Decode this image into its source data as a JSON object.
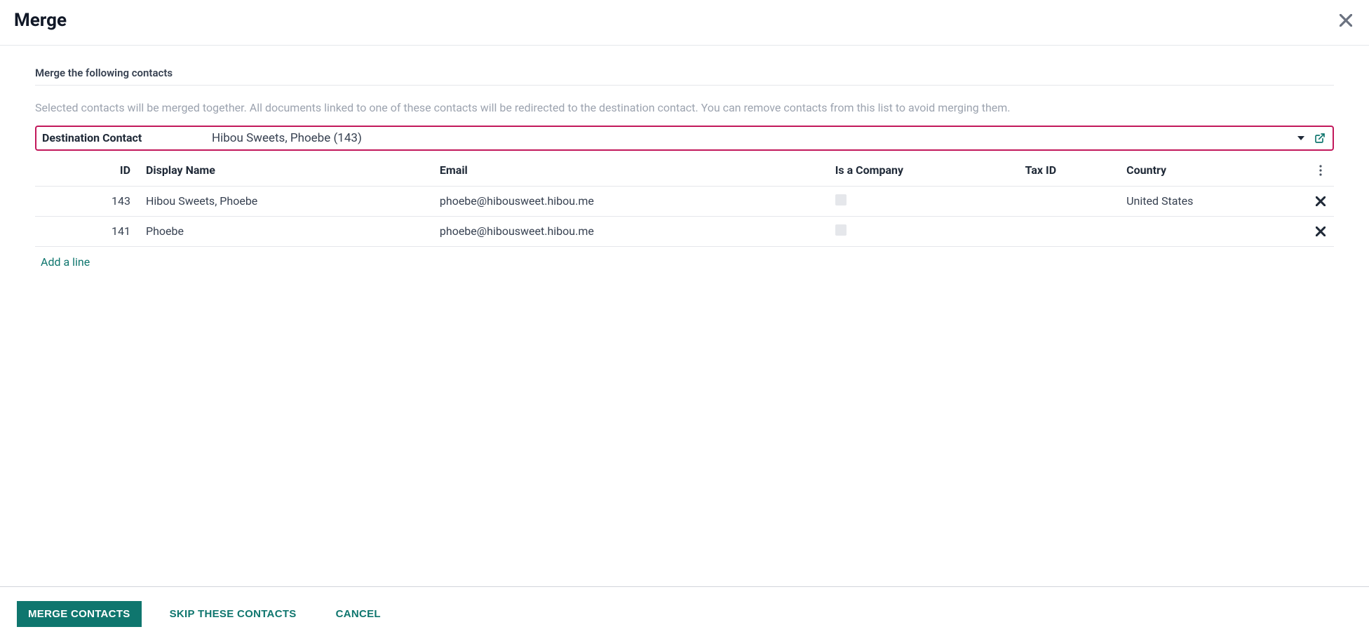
{
  "modal": {
    "title": "Merge",
    "section_title": "Merge the following contacts",
    "description": "Selected contacts will be merged together. All documents linked to one of these contacts will be redirected to the destination contact. You can remove contacts from this list to avoid merging them.",
    "destination": {
      "label": "Destination Contact",
      "value": "Hibou Sweets, Phoebe (143)"
    },
    "table": {
      "headers": {
        "id": "ID",
        "display_name": "Display Name",
        "email": "Email",
        "is_company": "Is a Company",
        "tax_id": "Tax ID",
        "country": "Country"
      },
      "rows": [
        {
          "id": "143",
          "display_name": "Hibou Sweets, Phoebe",
          "email": "phoebe@hibousweet.hibou.me",
          "is_company": false,
          "tax_id": "",
          "country": "United States"
        },
        {
          "id": "141",
          "display_name": "Phoebe",
          "email": "phoebe@hibousweet.hibou.me",
          "is_company": false,
          "tax_id": "",
          "country": ""
        }
      ],
      "add_line": "Add a line"
    },
    "footer": {
      "merge": "MERGE CONTACTS",
      "skip": "SKIP THESE CONTACTS",
      "cancel": "CANCEL"
    }
  },
  "colors": {
    "primary": "#0f766e",
    "highlight_border": "#c2185b"
  }
}
